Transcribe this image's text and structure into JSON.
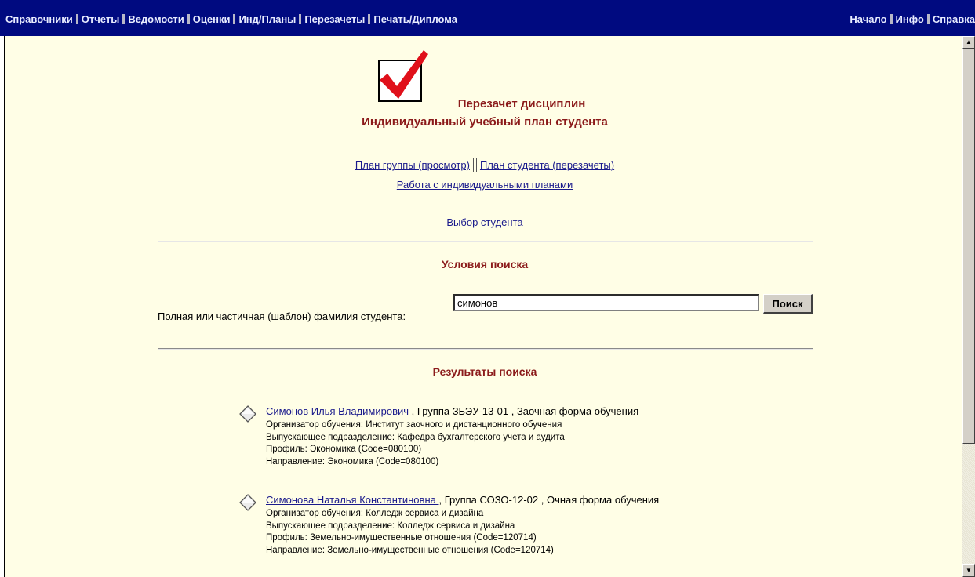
{
  "nav": {
    "left": [
      "Справочники",
      "Отчеты",
      "Ведомости",
      "Оценки",
      "Инд/Планы",
      "Перезачеты",
      "Печать/Диплома"
    ],
    "right": [
      "Начало",
      "Инфо",
      "Справка"
    ]
  },
  "header": {
    "title1": "Перезачет дисциплин",
    "title2": "Индивидуальный учебный план студента"
  },
  "links": {
    "group_plan": "План группы (просмотр)",
    "student_plan": "План студента (перезачеты)",
    "individual_plans": "Работа с индивидуальными планами",
    "choose_student": "Выбор студента "
  },
  "search": {
    "section_title": "Условия поиска",
    "label": "Полная или частичная (шаблон) фамилия студента:",
    "value": "симонов",
    "button": "Поиск"
  },
  "results": {
    "section_title": "Результаты поиска",
    "items": [
      {
        "name": "Симонов Илья Владимирович ",
        "group_info": ", Группа ЗБЭУ-13-01 , Заочная форма обучения",
        "organizer": "Организатор обучения: Институт заочного и дистанционного обучения",
        "department": "Выпускающее подразделение: Кафедра бухгалтерского учета и аудита",
        "profile": "Профиль: Экономика (Code=080100)",
        "direction": "Направление: Экономика (Code=080100)"
      },
      {
        "name": "Симонова Наталья Константиновна ",
        "group_info": ", Группа СОЗО-12-02 , Очная форма обучения",
        "organizer": "Организатор обучения: Колледж сервиса и дизайна",
        "department": "Выпускающее подразделение: Колледж сервиса и дизайна",
        "profile": "Профиль: Земельно-имущественные отношения (Code=120714)",
        "direction": "Направление: Земельно-имущественные отношения (Code=120714)"
      }
    ]
  },
  "colors": {
    "nav_bg": "#000a80",
    "page_bg": "#fffee6",
    "title": "#8b1a1a",
    "link": "#1a1a8c",
    "check": "#e0101a"
  },
  "icons": {
    "logo": "checkmark-icon",
    "result_marker": "diamond-icon"
  }
}
